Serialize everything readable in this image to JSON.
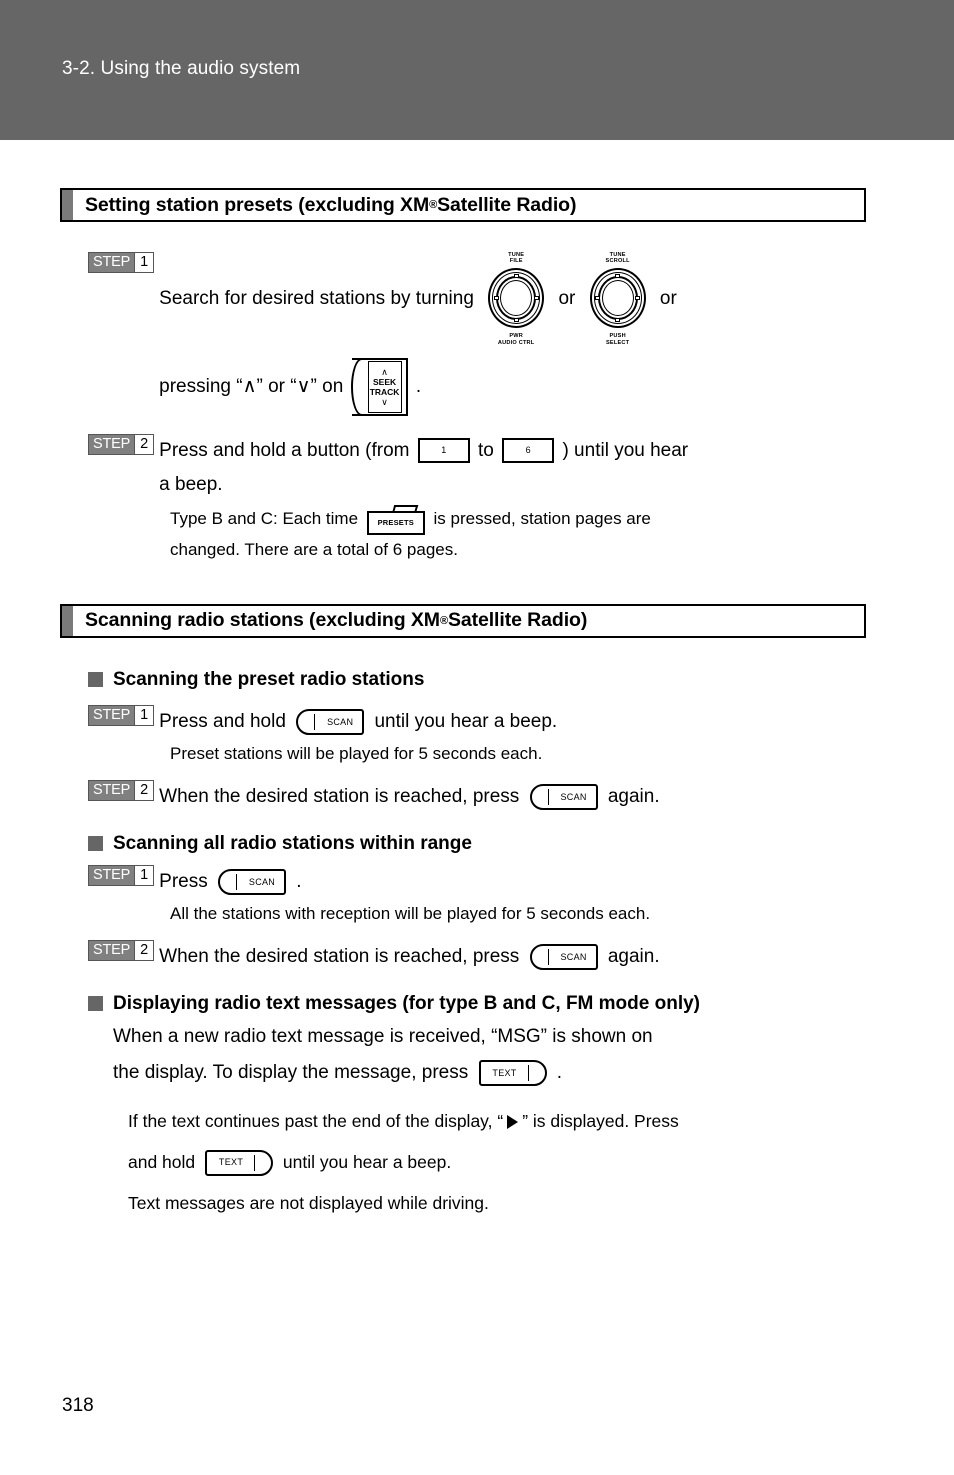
{
  "header": {
    "chapter_title": "3-2. Using the audio system"
  },
  "sections": [
    {
      "id": "setting-presets",
      "title_before": "Setting station presets (excluding XM",
      "title_sup": "®",
      "title_after": " Satellite Radio)",
      "steps": [
        {
          "step_word": "STEP",
          "step_num": "1",
          "text_a": "Search  for  desired  stations  by  turning",
          "text_or1": "or",
          "text_or2": "or",
          "text_b_pre": "pressing “",
          "text_b_mid1": "” or “",
          "text_b_mid2": "” on",
          "text_b_end": "."
        },
        {
          "step_word": "STEP",
          "step_num": "2",
          "text_a": "Press and hold a button (from",
          "text_to": "to",
          "text_b": ") until you hear",
          "text_c": "a beep.",
          "note_a": "Type  B  and  C:  Each  time",
          "note_b": "is  pressed,  station  pages  are",
          "note_c": "changed. There are a total of 6 pages."
        }
      ]
    },
    {
      "id": "scanning-stations",
      "title_before": "Scanning radio stations (excluding XM",
      "title_sup": "®",
      "title_after": " Satellite Radio)",
      "subsections": [
        {
          "heading": "Scanning the preset radio stations",
          "steps": [
            {
              "step_word": "STEP",
              "step_num": "1",
              "text_a": "Press and hold",
              "text_b": "until you hear a beep.",
              "note": "Preset stations will be played for 5 seconds each."
            },
            {
              "step_word": "STEP",
              "step_num": "2",
              "text_a": "When the desired station is reached, press",
              "text_b": "again."
            }
          ]
        },
        {
          "heading": "Scanning all radio stations within range",
          "steps": [
            {
              "step_word": "STEP",
              "step_num": "1",
              "text_a": "Press",
              "text_b": ".",
              "note": "All the stations with reception will be played for 5 seconds each."
            },
            {
              "step_word": "STEP",
              "step_num": "2",
              "text_a": "When the desired station is reached, press",
              "text_b": "again."
            }
          ]
        },
        {
          "heading": "Displaying radio text messages (for type B and C, FM mode only)",
          "paragraphs": [
            "When  a  new  radio  text  message  is  received,  “MSG”  is  shown  on",
            "the display. To display the message, press"
          ],
          "paragraph_end": ".",
          "notes": {
            "note1_a": "If the text continues past the end of the display, “",
            "note1_b": "” is displayed. Press",
            "note2_a": "and hold",
            "note2_b": "until you hear a beep.",
            "note3": "Text messages are not displayed while driving."
          }
        }
      ]
    }
  ],
  "icons": {
    "knob_tune_file": {
      "name": "tune-file-knob",
      "top_line1": "TUNE",
      "top_line2": "FILE",
      "bottom_line1": "PWR",
      "bottom_line2": "AUDIO CTRL"
    },
    "knob_tune_scroll": {
      "name": "tune-scroll-knob",
      "top_line1": "TUNE",
      "top_line2": "SCROLL",
      "bottom_line1": "PUSH",
      "bottom_line2": "SELECT"
    },
    "seek_track": {
      "up": "∧",
      "line1": "SEEK",
      "line2": "TRACK",
      "down": "∨"
    },
    "preset_first": "1",
    "preset_last": "6",
    "presets_key": "PRESETS",
    "scan_key": "SCAN",
    "text_key": "TEXT",
    "chevron_up": "∧",
    "chevron_down": "∨"
  },
  "footer": {
    "page_number": "318"
  },
  "colors": {
    "header_band": "#666666",
    "step_badge": "#808080",
    "section_tab": "#7a7a7a",
    "bullet": "#666666",
    "text": "#000000",
    "background": "#ffffff"
  }
}
